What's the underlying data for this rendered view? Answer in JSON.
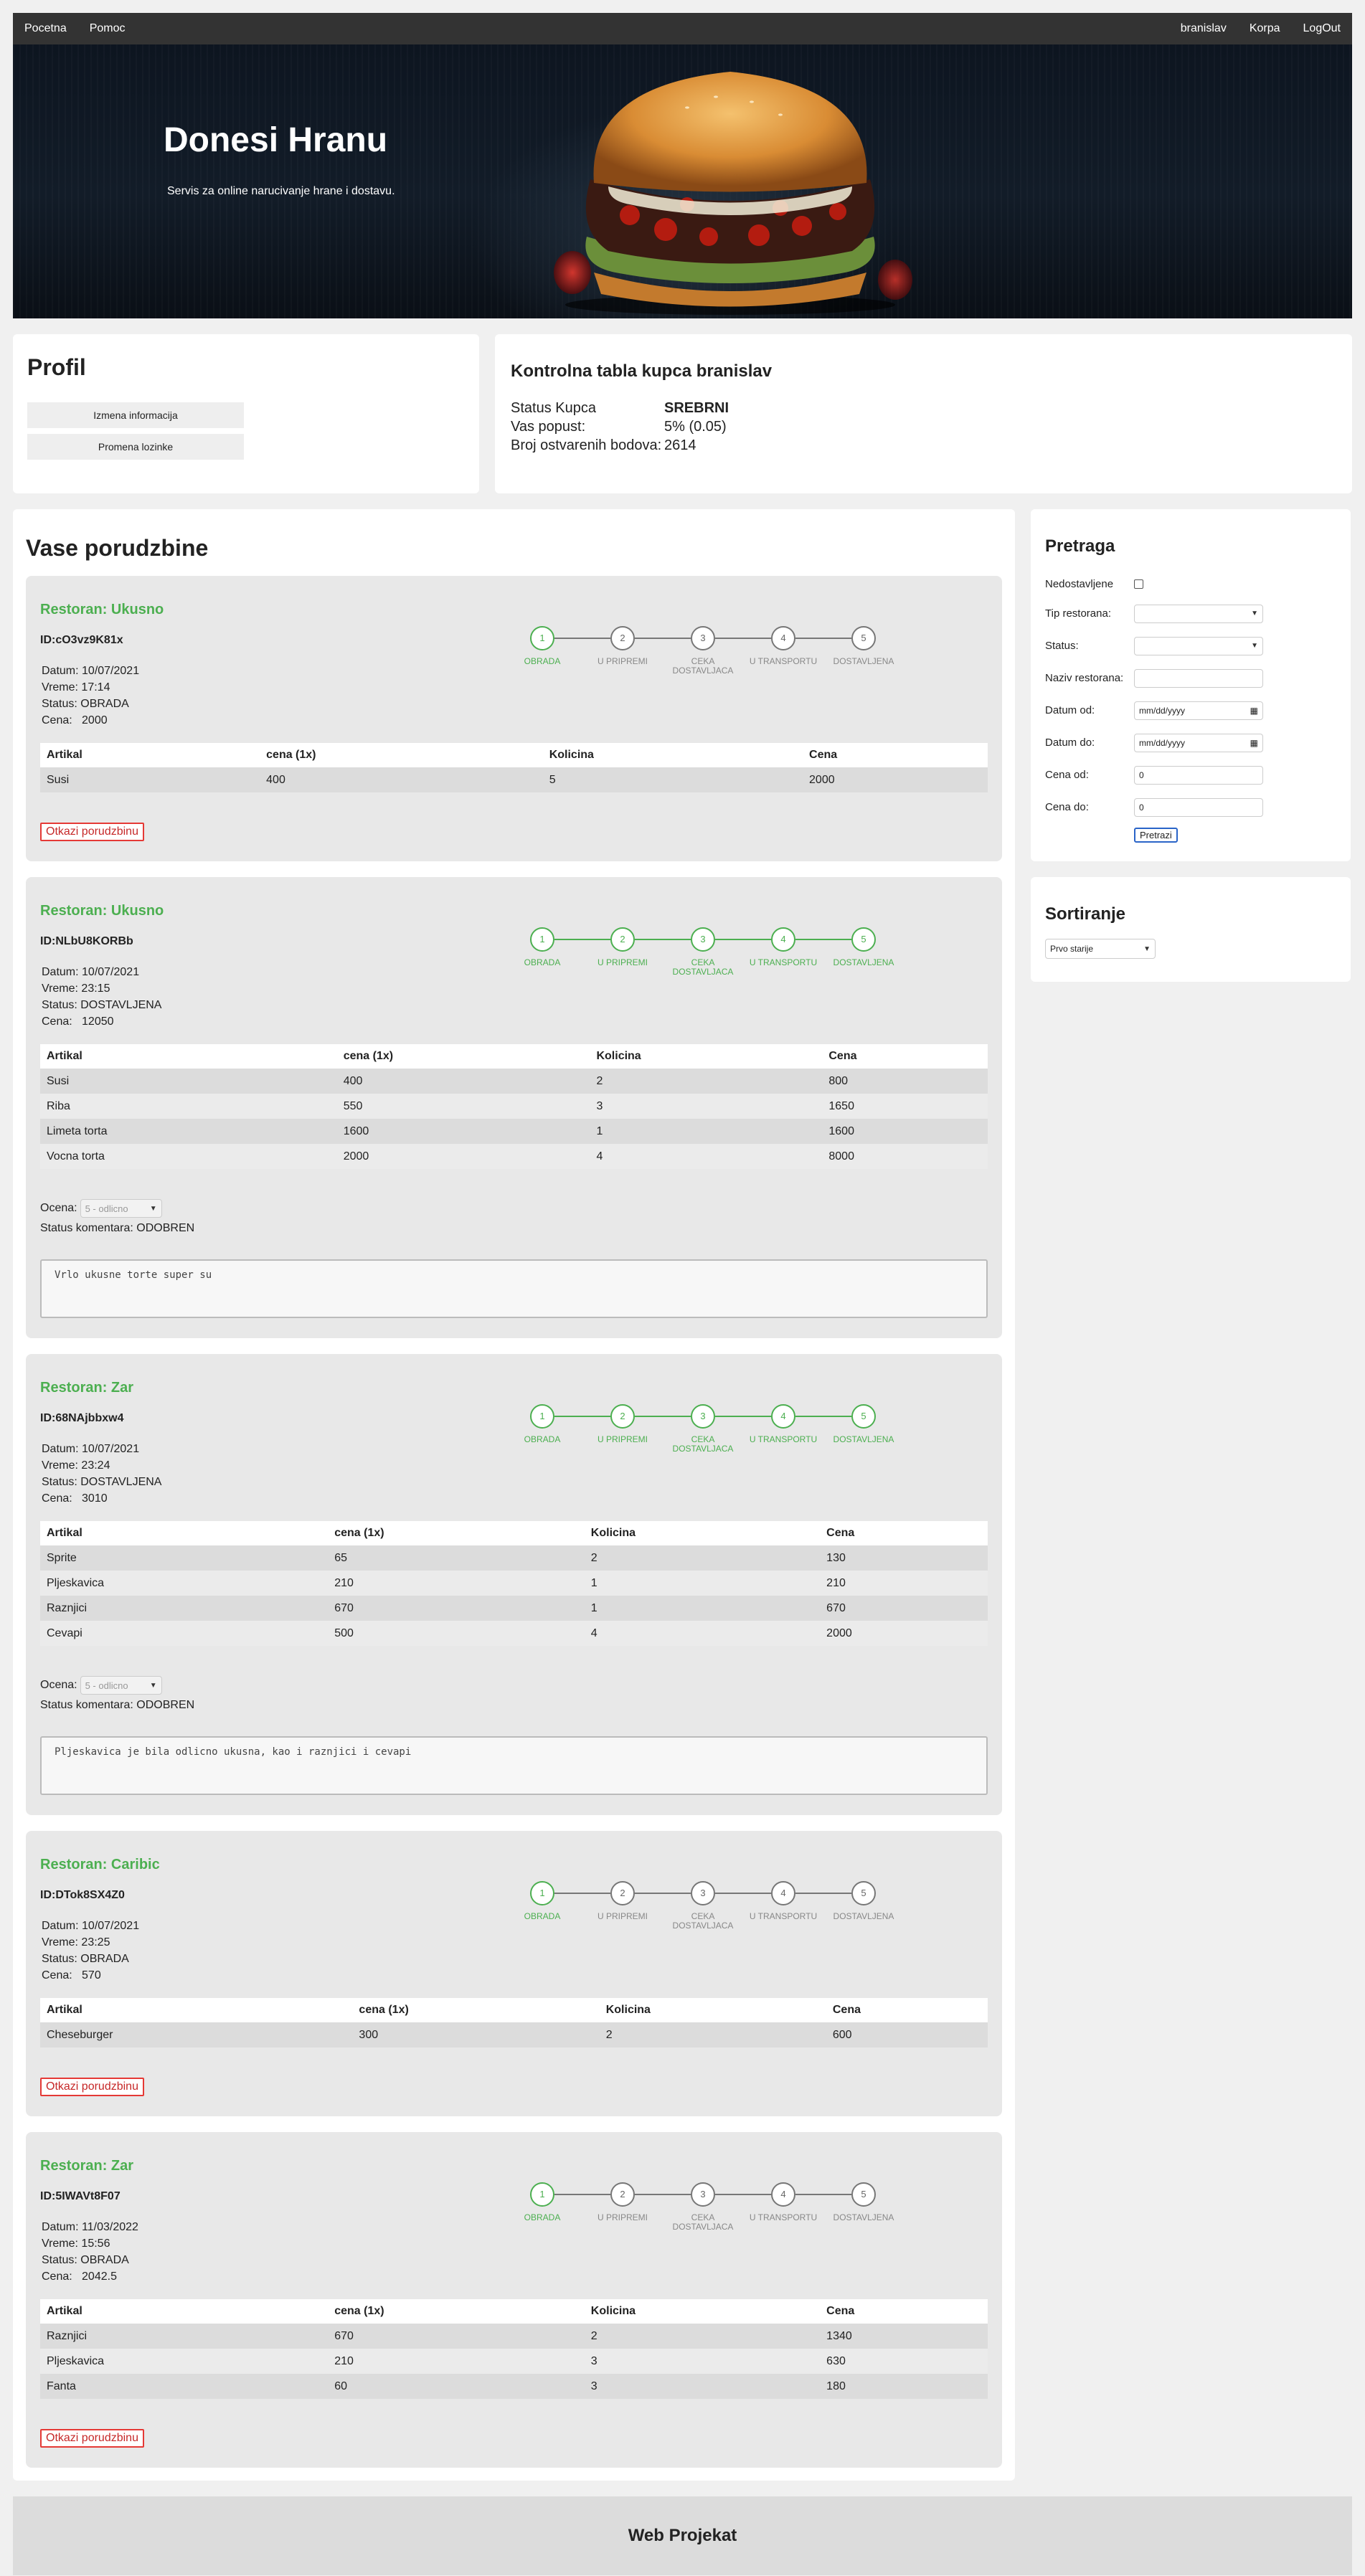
{
  "nav": {
    "left": [
      "Pocetna",
      "Pomoc"
    ],
    "right": [
      "branislav",
      "Korpa",
      "LogOut"
    ]
  },
  "hero": {
    "title": "Donesi Hranu",
    "subtitle": "Servis za online narucivanje hrane i dostavu."
  },
  "profile": {
    "title": "Profil",
    "edit_info": "Izmena informacija",
    "change_password": "Promena lozinke"
  },
  "dashboard": {
    "title": "Kontrolna tabla kupca branislav",
    "rows": [
      {
        "key": "Status Kupca",
        "value": "SREBRNI"
      },
      {
        "key": "Vas popust:",
        "value": "5% (0.05)"
      },
      {
        "key": "Broj ostvarenih bodova:",
        "value": "2614"
      }
    ]
  },
  "orders": {
    "title": "Vase porudzbine",
    "step_labels": [
      "OBRADA",
      "U PRIPREMI",
      "CEKA DOSTAVLJACA",
      "U TRANSPORTU",
      "DOSTAVLJENA"
    ],
    "headers": [
      "Artikal",
      "cena (1x)",
      "Kolicina",
      "Cena"
    ],
    "cancel_label": "Otkazi porudzbinu",
    "rating_label": "Ocena:",
    "rating_value": "5 - odlicno",
    "comment_status_label": "Status komentara:",
    "list": [
      {
        "restaurant": "Restoran: Ukusno",
        "id": "ID:cO3vz9K81x",
        "datum": "Datum: 10/07/2021",
        "vreme": "Vreme: 17:14",
        "status": "Status: OBRADA",
        "cena": "Cena:   2000",
        "progress": 1,
        "items": [
          [
            "Susi",
            "400",
            "5",
            "2000"
          ]
        ],
        "cancellable": true
      },
      {
        "restaurant": "Restoran: Ukusno",
        "id": "ID:NLbU8KORBb",
        "datum": "Datum: 10/07/2021",
        "vreme": "Vreme: 23:15",
        "status": "Status: DOSTAVLJENA",
        "cena": "Cena:   12050",
        "progress": 5,
        "items": [
          [
            "Susi",
            "400",
            "2",
            "800"
          ],
          [
            "Riba",
            "550",
            "3",
            "1650"
          ],
          [
            "Limeta torta",
            "1600",
            "1",
            "1600"
          ],
          [
            "Vocna torta",
            "2000",
            "4",
            "8000"
          ]
        ],
        "comment_status": "ODOBREN",
        "comment": "Vrlo ukusne torte super su"
      },
      {
        "restaurant": "Restoran: Zar",
        "id": "ID:68NAjbbxw4",
        "datum": "Datum: 10/07/2021",
        "vreme": "Vreme: 23:24",
        "status": "Status: DOSTAVLJENA",
        "cena": "Cena:   3010",
        "progress": 5,
        "items": [
          [
            "Sprite",
            "65",
            "2",
            "130"
          ],
          [
            "Pljeskavica",
            "210",
            "1",
            "210"
          ],
          [
            "Raznjici",
            "670",
            "1",
            "670"
          ],
          [
            "Cevapi",
            "500",
            "4",
            "2000"
          ]
        ],
        "comment_status": "ODOBREN",
        "comment": "Pljeskavica je bila odlicno ukusna, kao i raznjici i cevapi"
      },
      {
        "restaurant": "Restoran: Caribic",
        "id": "ID:DTok8SX4Z0",
        "datum": "Datum: 10/07/2021",
        "vreme": "Vreme: 23:25",
        "status": "Status: OBRADA",
        "cena": "Cena:   570",
        "progress": 1,
        "items": [
          [
            "Cheseburger",
            "300",
            "2",
            "600"
          ]
        ],
        "cancellable": true
      },
      {
        "restaurant": "Restoran: Zar",
        "id": "ID:5IWAVt8F07",
        "datum": "Datum: 11/03/2022",
        "vreme": "Vreme: 15:56",
        "status": "Status: OBRADA",
        "cena": "Cena:   2042.5",
        "progress": 1,
        "items": [
          [
            "Raznjici",
            "670",
            "2",
            "1340"
          ],
          [
            "Pljeskavica",
            "210",
            "3",
            "630"
          ],
          [
            "Fanta",
            "60",
            "3",
            "180"
          ]
        ],
        "cancellable": true
      }
    ]
  },
  "search": {
    "title": "Pretraga",
    "undelivered_label": "Nedostavljene",
    "type_label": "Tip restorana:",
    "status_label": "Status:",
    "name_label": "Naziv restorana:",
    "date_from_label": "Datum od:",
    "date_to_label": "Datum do:",
    "date_placeholder": "mm/dd/yyyy",
    "price_from_label": "Cena od:",
    "price_to_label": "Cena do:",
    "price_from_value": "0",
    "price_to_value": "0",
    "button": "Pretrazi"
  },
  "sort": {
    "title": "Sortiranje",
    "selected": "Prvo starije"
  },
  "footer": {
    "text": "Web Projekat"
  },
  "colors": {
    "accent_green": "#4caf50",
    "cancel_red": "#e53935",
    "nav_bg": "#333333"
  }
}
